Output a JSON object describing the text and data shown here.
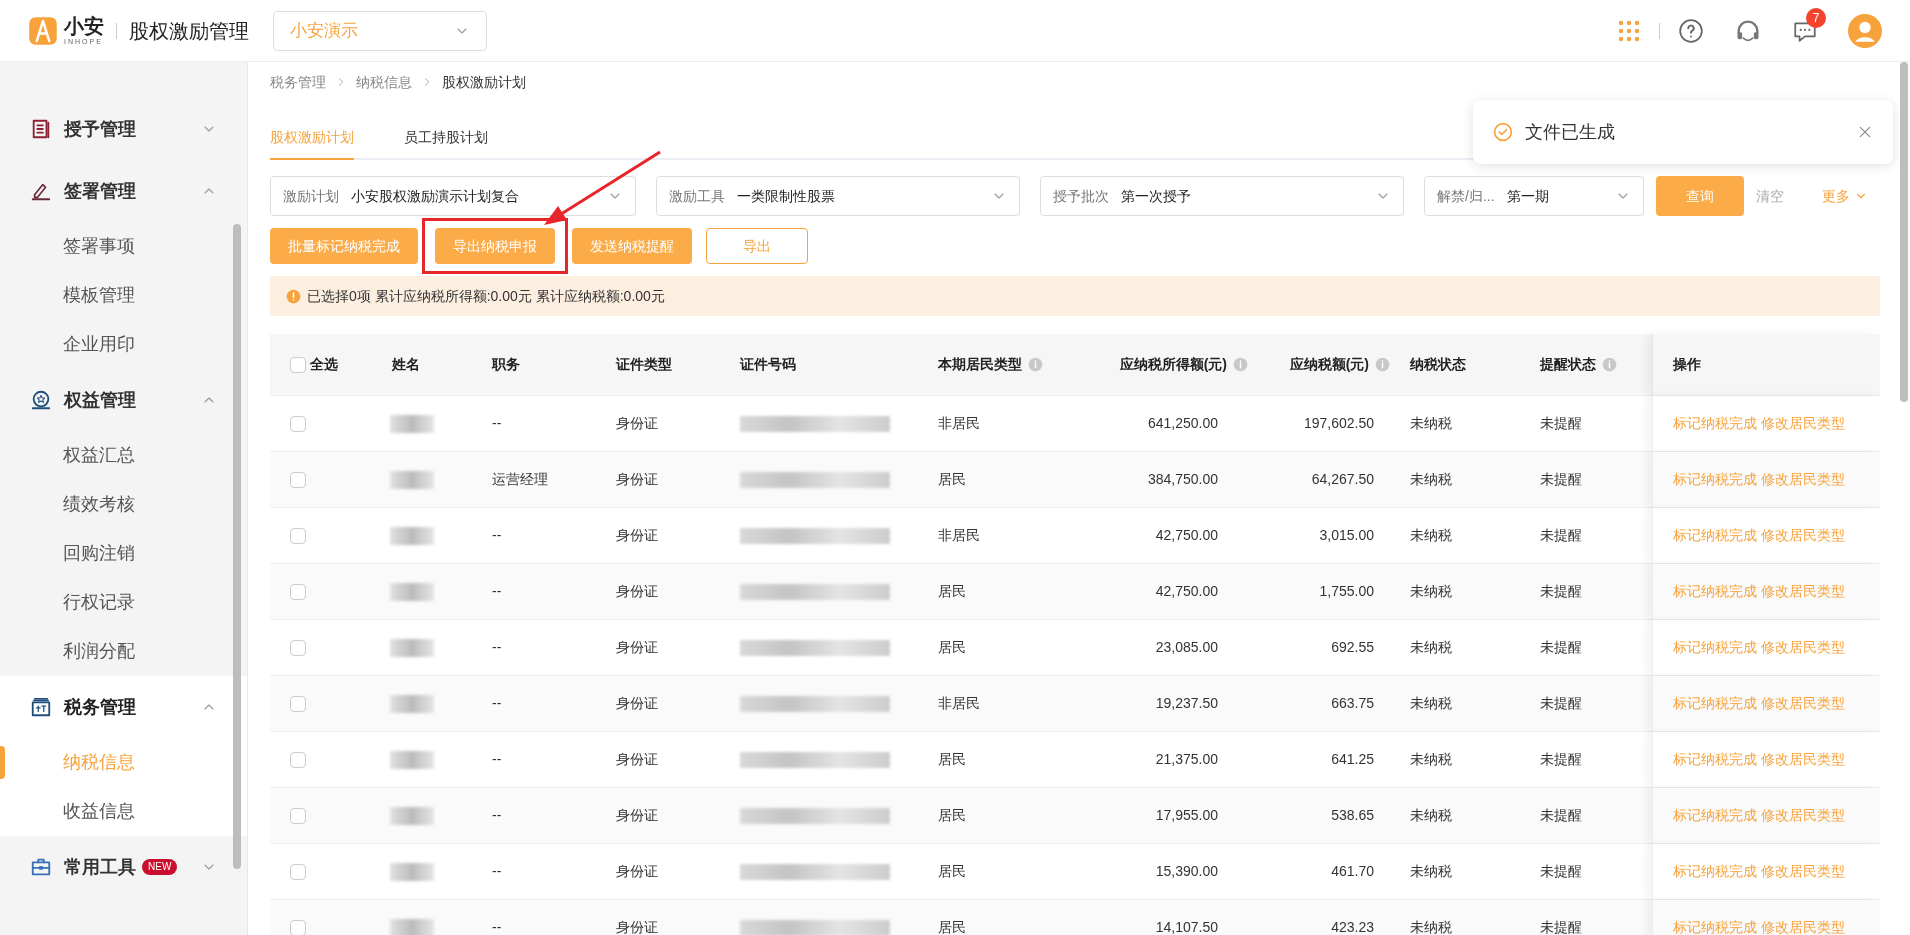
{
  "header": {
    "logo_text": "小安",
    "logo_sub": "INHOPE",
    "app_title": "股权激励管理",
    "company_select": "小安演示",
    "message_count": "7"
  },
  "sidebar": {
    "items": [
      {
        "label": "授予管理",
        "expanded": false,
        "selected": false
      },
      {
        "label": "签署管理",
        "expanded": true,
        "selected": false,
        "children": [
          {
            "label": "签署事项",
            "selected": false
          },
          {
            "label": "模板管理",
            "selected": false
          },
          {
            "label": "企业用印",
            "selected": false
          }
        ]
      },
      {
        "label": "权益管理",
        "expanded": true,
        "selected": false,
        "children": [
          {
            "label": "权益汇总",
            "selected": false
          },
          {
            "label": "绩效考核",
            "selected": false
          },
          {
            "label": "回购注销",
            "selected": false
          },
          {
            "label": "行权记录",
            "selected": false
          },
          {
            "label": "利润分配",
            "selected": false
          }
        ]
      },
      {
        "label": "税务管理",
        "expanded": true,
        "selected": true,
        "children": [
          {
            "label": "纳税信息",
            "selected": true
          },
          {
            "label": "收益信息",
            "selected": false
          }
        ]
      },
      {
        "label": "常用工具",
        "expanded": false,
        "selected": false,
        "badge": "NEW"
      }
    ]
  },
  "breadcrumb": [
    "税务管理",
    "纳税信息",
    "股权激励计划"
  ],
  "tabs": [
    {
      "label": "股权激励计划",
      "selected": true
    },
    {
      "label": "员工持股计划",
      "selected": false
    }
  ],
  "filters": [
    {
      "label": "激励计划",
      "value": "小安股权激励演示计划复合"
    },
    {
      "label": "激励工具",
      "value": "一类限制性股票"
    },
    {
      "label": "授予批次",
      "value": "第一次授予"
    },
    {
      "label": "解禁/归...",
      "value": "第一期"
    }
  ],
  "filter_actions": {
    "query": "查询",
    "clear": "清空",
    "more": "更多"
  },
  "actions": [
    {
      "label": "批量标记纳税完成",
      "kind": "primary"
    },
    {
      "label": "导出纳税申报",
      "kind": "primary"
    },
    {
      "label": "发送纳税提醒",
      "kind": "primary"
    },
    {
      "label": "导出",
      "kind": "outline"
    }
  ],
  "summary": "已选择0项 累计应纳税所得额:0.00元 累计应纳税额:0.00元",
  "toast": {
    "message": "文件已生成"
  },
  "table": {
    "select_all": {
      "label": "全选",
      "checked": false
    },
    "columns": [
      {
        "label": "姓名"
      },
      {
        "label": "职务"
      },
      {
        "label": "证件类型"
      },
      {
        "label": "证件号码"
      },
      {
        "label": "本期居民类型",
        "info": true
      },
      {
        "label": "应纳税所得额(元)",
        "info": true
      },
      {
        "label": "应纳税额(元)",
        "info": true
      },
      {
        "label": "纳税状态"
      },
      {
        "label": "提醒状态",
        "info": true
      },
      {
        "label": "操作"
      }
    ],
    "rows": [
      {
        "checked": false,
        "position": "--",
        "id_type": "身份证",
        "residency": "非居民",
        "income": "641,250.00",
        "tax": "197,602.50",
        "tax_status": "未纳税",
        "reminder": "未提醒",
        "actions": [
          "标记纳税完成",
          "修改居民类型"
        ]
      },
      {
        "checked": false,
        "position": "运营经理",
        "id_type": "身份证",
        "residency": "居民",
        "income": "384,750.00",
        "tax": "64,267.50",
        "tax_status": "未纳税",
        "reminder": "未提醒",
        "actions": [
          "标记纳税完成",
          "修改居民类型"
        ]
      },
      {
        "checked": false,
        "position": "--",
        "id_type": "身份证",
        "residency": "非居民",
        "income": "42,750.00",
        "tax": "3,015.00",
        "tax_status": "未纳税",
        "reminder": "未提醒",
        "actions": [
          "标记纳税完成",
          "修改居民类型"
        ]
      },
      {
        "checked": false,
        "position": "--",
        "id_type": "身份证",
        "residency": "居民",
        "income": "42,750.00",
        "tax": "1,755.00",
        "tax_status": "未纳税",
        "reminder": "未提醒",
        "actions": [
          "标记纳税完成",
          "修改居民类型"
        ]
      },
      {
        "checked": false,
        "position": "--",
        "id_type": "身份证",
        "residency": "居民",
        "income": "23,085.00",
        "tax": "692.55",
        "tax_status": "未纳税",
        "reminder": "未提醒",
        "actions": [
          "标记纳税完成",
          "修改居民类型"
        ]
      },
      {
        "checked": false,
        "position": "--",
        "id_type": "身份证",
        "residency": "非居民",
        "income": "19,237.50",
        "tax": "663.75",
        "tax_status": "未纳税",
        "reminder": "未提醒",
        "actions": [
          "标记纳税完成",
          "修改居民类型"
        ]
      },
      {
        "checked": false,
        "position": "--",
        "id_type": "身份证",
        "residency": "居民",
        "income": "21,375.00",
        "tax": "641.25",
        "tax_status": "未纳税",
        "reminder": "未提醒",
        "actions": [
          "标记纳税完成",
          "修改居民类型"
        ]
      },
      {
        "checked": false,
        "position": "--",
        "id_type": "身份证",
        "residency": "居民",
        "income": "17,955.00",
        "tax": "538.65",
        "tax_status": "未纳税",
        "reminder": "未提醒",
        "actions": [
          "标记纳税完成",
          "修改居民类型"
        ]
      },
      {
        "checked": false,
        "position": "--",
        "id_type": "身份证",
        "residency": "居民",
        "income": "15,390.00",
        "tax": "461.70",
        "tax_status": "未纳税",
        "reminder": "未提醒",
        "actions": [
          "标记纳税完成",
          "修改居民类型"
        ]
      },
      {
        "checked": false,
        "position": "--",
        "id_type": "身份证",
        "residency": "居民",
        "income": "14,107.50",
        "tax": "423.23",
        "tax_status": "未纳税",
        "reminder": "未提醒",
        "actions": [
          "标记纳税完成",
          "修改居民类型"
        ]
      }
    ]
  }
}
